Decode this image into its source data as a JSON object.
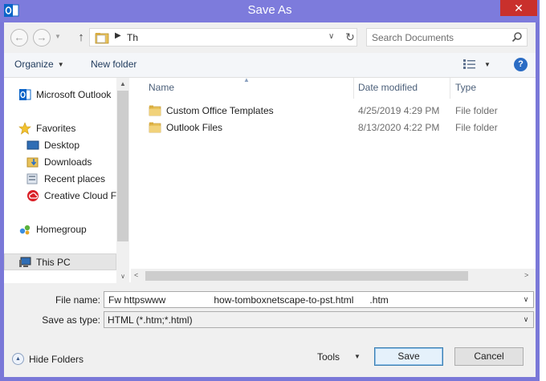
{
  "window": {
    "title": "Save As",
    "close_glyph": "✕",
    "app_icon": "outlook-icon"
  },
  "address": {
    "back_glyph": "←",
    "forward_glyph": "→",
    "up_glyph": "↑",
    "path_separator": "▶",
    "current_folder": "Th",
    "dropdown_glyph": "∨",
    "refresh_glyph": "↻"
  },
  "search": {
    "placeholder": "Search Documents"
  },
  "toolbar": {
    "organize_label": "Organize",
    "new_folder_label": "New folder",
    "caret_glyph": "▼",
    "help_glyph": "?"
  },
  "nav_pane": {
    "items": [
      {
        "label": "Microsoft Outlook",
        "icon": "outlook-icon"
      },
      {
        "label": "Favorites",
        "icon": "star-icon"
      },
      {
        "label": "Desktop",
        "icon": "desktop-icon"
      },
      {
        "label": "Downloads",
        "icon": "downloads-icon"
      },
      {
        "label": "Recent places",
        "icon": "recent-places-icon"
      },
      {
        "label": "Creative Cloud Fi",
        "icon": "creative-cloud-icon"
      },
      {
        "label": "Homegroup",
        "icon": "homegroup-icon"
      },
      {
        "label": "This PC",
        "icon": "computer-icon"
      }
    ],
    "scroll_up_glyph": "▲",
    "scroll_down_glyph": "∨"
  },
  "file_list": {
    "columns": [
      "Name",
      "Date modified",
      "Type"
    ],
    "sort_glyph": "▲",
    "rows": [
      {
        "name": "Custom Office Templates",
        "date": "4/25/2019 4:29 PM",
        "type": "File folder"
      },
      {
        "name": "Outlook Files",
        "date": "8/13/2020 4:22 PM",
        "type": "File folder"
      }
    ],
    "hscroll_left_glyph": "<",
    "hscroll_right_glyph": ">"
  },
  "fields": {
    "file_name_label": "File name:",
    "file_name_value": "Fw httpswww                  how-tomboxnetscape-to-pst.html      .htm",
    "save_as_type_label": "Save as type:",
    "save_as_type_value": "HTML (*.htm;*.html)",
    "dropdown_glyph": "∨"
  },
  "footer": {
    "hide_folders_label": "Hide Folders",
    "hide_folders_glyph": "▲",
    "tools_label": "Tools",
    "tools_caret": "▼",
    "save_label": "Save",
    "cancel_label": "Cancel"
  },
  "colors": {
    "title_bar": "#7d7bdc",
    "close_button": "#c9302c",
    "folder": "#e8c25a",
    "accent": "#3c7fb1"
  }
}
